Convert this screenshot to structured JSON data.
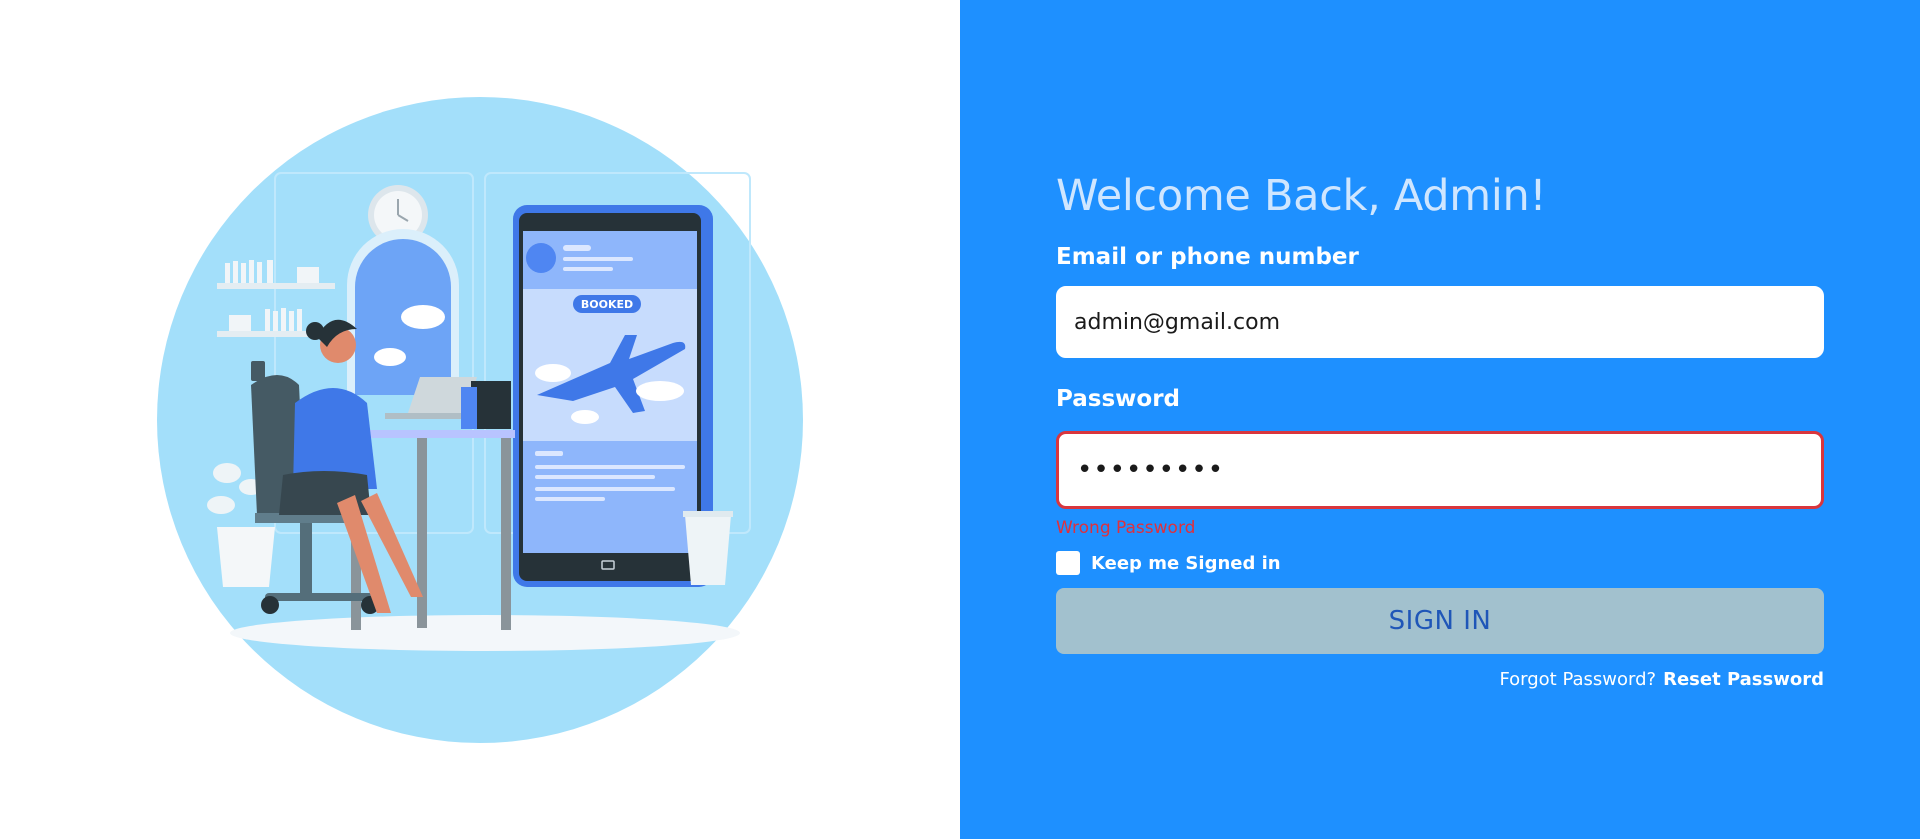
{
  "colors": {
    "panel_blue": "#1e90ff",
    "title_color": "#cfe6ff",
    "error_red": "#d9363e",
    "button_bg": "#a2c1ce",
    "button_text": "#1f56b8",
    "illustration_circle": "#a3dffa"
  },
  "illustration": {
    "icon": "travel-booking-illustration",
    "badge_text": "BOOKED"
  },
  "login": {
    "title": "Welcome Back, Admin!",
    "email_label": "Email or phone number",
    "email_value": "admin@gmail.com",
    "password_label": "Password",
    "password_value": "•••••••••",
    "error_message": "Wrong Password",
    "remember_label": "Keep me Signed in",
    "remember_checked": false,
    "submit_label": "SIGN IN",
    "forgot_text": "Forgot Password?",
    "reset_link": "Reset Password"
  }
}
